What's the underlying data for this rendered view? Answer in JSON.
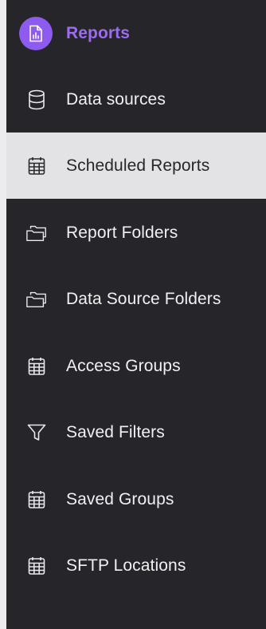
{
  "nav": {
    "brand": {
      "label": "Reports",
      "icon": "report-icon"
    },
    "items": [
      {
        "label": "Data sources",
        "icon": "database-icon",
        "active": false
      },
      {
        "label": "Scheduled Reports",
        "icon": "calendar-icon",
        "active": true
      },
      {
        "label": "Report Folders",
        "icon": "folders-icon",
        "active": false
      },
      {
        "label": "Data Source Folders",
        "icon": "folders-icon",
        "active": false
      },
      {
        "label": "Access Groups",
        "icon": "calendar-icon",
        "active": false
      },
      {
        "label": "Saved Filters",
        "icon": "filter-icon",
        "active": false
      },
      {
        "label": "Saved Groups",
        "icon": "calendar-icon",
        "active": false
      },
      {
        "label": "SFTP Locations",
        "icon": "calendar-icon",
        "active": false
      }
    ]
  },
  "colors": {
    "sidebar_bg": "#25252a",
    "active_bg": "#e3e3e5",
    "brand_accent": "#9b6cf2",
    "label_text": "#f1f1f3"
  }
}
